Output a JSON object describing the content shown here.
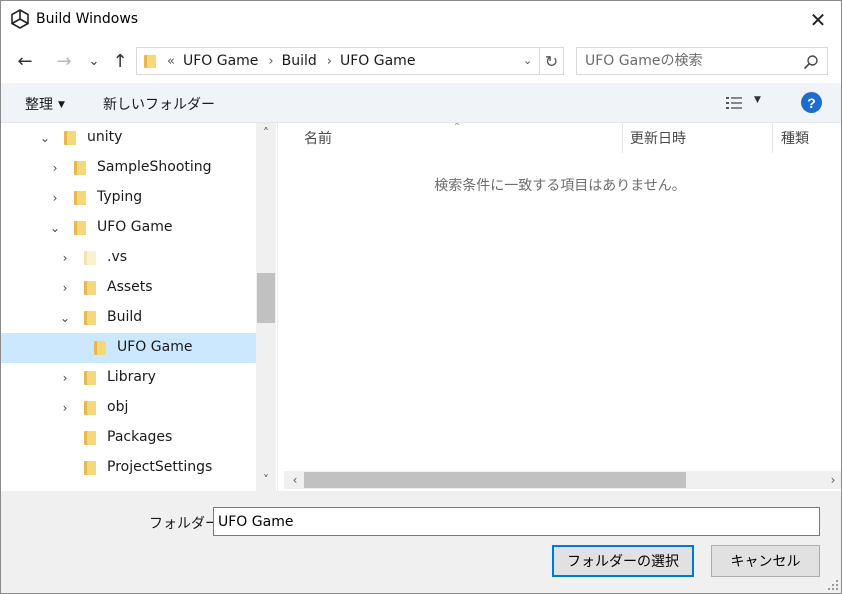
{
  "window": {
    "title": "Build Windows",
    "close_glyph": "✕"
  },
  "nav": {
    "back_glyph": "←",
    "forward_glyph": "→",
    "recent_glyph": "⌄",
    "up_glyph": "↑"
  },
  "address": {
    "overflow_glyph": "«",
    "crumbs": [
      "UFO Game",
      "Build",
      "UFO Game"
    ],
    "separator": "›",
    "dropdown_glyph": "⌄",
    "refresh_glyph": "↻"
  },
  "search": {
    "placeholder": "UFO Gameの検索",
    "icon": "search-icon"
  },
  "toolbar": {
    "organize_label": "整理",
    "new_folder_label": "新しいフォルダー",
    "view_icon": "details-view-icon",
    "help_label": "?"
  },
  "tree": {
    "items": [
      {
        "label": "unity",
        "expander": "⌄"
      },
      {
        "label": "SampleShooting",
        "expander": "›"
      },
      {
        "label": "Typing",
        "expander": "›"
      },
      {
        "label": "UFO Game",
        "expander": "⌄"
      },
      {
        "label": ".vs",
        "expander": "›"
      },
      {
        "label": "Assets",
        "expander": "›"
      },
      {
        "label": "Build",
        "expander": "⌄"
      },
      {
        "label": "UFO Game",
        "expander": ""
      },
      {
        "label": "Library",
        "expander": "›"
      },
      {
        "label": "obj",
        "expander": "›"
      },
      {
        "label": "Packages",
        "expander": ""
      },
      {
        "label": "ProjectSettings",
        "expander": ""
      }
    ],
    "selected_index": 7,
    "scroll_up_glyph": "˄",
    "scroll_down_glyph": "˅"
  },
  "columns": {
    "name": "名前",
    "date": "更新日時",
    "type": "種類",
    "sort_glyph": "˄"
  },
  "content": {
    "empty_message": "検索条件に一致する項目はありません。",
    "scroll_left_glyph": "‹",
    "scroll_right_glyph": "›"
  },
  "footer": {
    "folder_label": "フォルダー:",
    "folder_value": "UFO Game",
    "select_button": "フォルダーの選択",
    "cancel_button": "キャンセル"
  },
  "colors": {
    "folder": "#e8b84a",
    "folder_light": "#f6d87c",
    "selection": "#cce8ff",
    "accent": "#0078d7",
    "help": "#1c6dd0"
  }
}
